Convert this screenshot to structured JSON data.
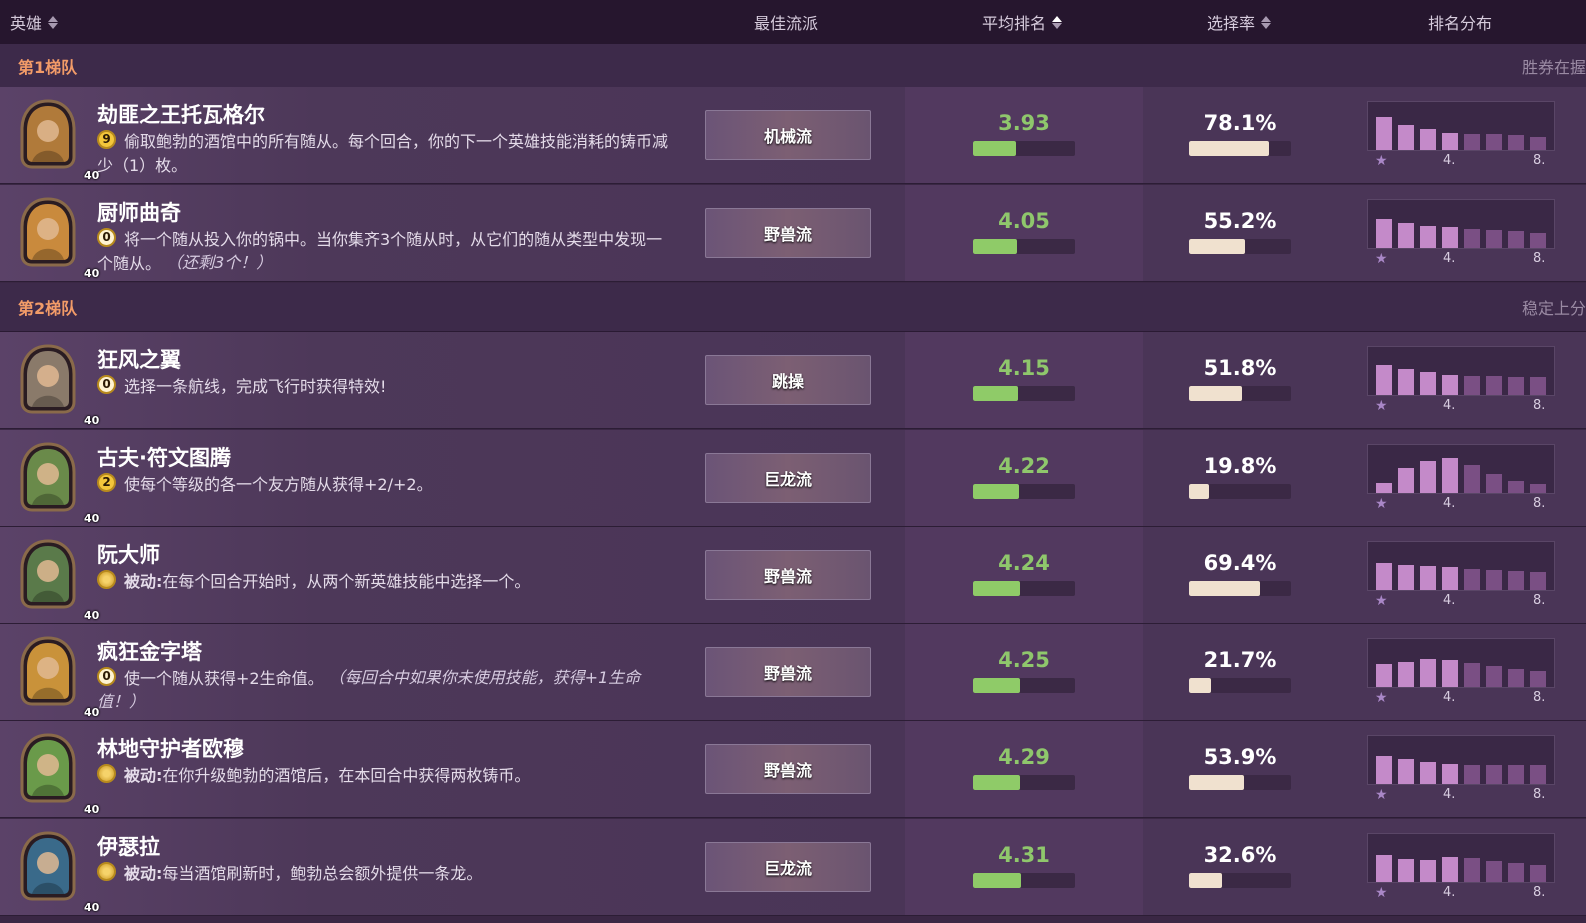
{
  "header": {
    "col_hero": "英雄",
    "col_comp": "最佳流派",
    "col_avg": "平均排名",
    "col_pick": "选择率",
    "col_dist": "排名分布"
  },
  "tiers": [
    {
      "name": "第1梯队",
      "note": "胜券在握"
    },
    {
      "name": "第2梯队",
      "note": "稳定上分"
    }
  ],
  "dist_labels": {
    "star": "★",
    "mid": "4.",
    "end": "8."
  },
  "heroes": [
    {
      "name": "劫匪之王托瓦格尔",
      "cost": "9",
      "desc": "偷取鲍勃的酒馆中的所有随从。每个回合，你的下一个英雄技能消耗的铸币减少（1）枚。",
      "desc_em": "",
      "level": "40",
      "comp": "机械流",
      "avg": "3.93",
      "avg_fill": 0.42,
      "pick": "78.1%",
      "pick_fill": 0.781,
      "dist": [
        0.72,
        0.55,
        0.45,
        0.38,
        0.35,
        0.34,
        0.33,
        0.28
      ],
      "portrait_color": "#b07a3a"
    },
    {
      "name": "厨师曲奇",
      "cost": "0",
      "desc": "将一个随从投入你的锅中。当你集齐3个随从时，从它们的随从类型中发现一个随从。",
      "desc_em": "（还剩3个！）",
      "level": "40",
      "comp": "野兽流",
      "avg": "4.05",
      "avg_fill": 0.43,
      "pick": "55.2%",
      "pick_fill": 0.552,
      "dist": [
        0.62,
        0.55,
        0.48,
        0.45,
        0.42,
        0.4,
        0.36,
        0.33
      ],
      "portrait_color": "#c98a3d"
    },
    {
      "name": "狂风之翼",
      "cost": "0",
      "desc": "选择一条航线，完成飞行时获得特效!",
      "desc_em": "",
      "level": "40",
      "comp": "跳操",
      "avg": "4.15",
      "avg_fill": 0.44,
      "pick": "51.8%",
      "pick_fill": 0.518,
      "dist": [
        0.66,
        0.56,
        0.5,
        0.44,
        0.42,
        0.42,
        0.4,
        0.39
      ],
      "portrait_color": "#8a7a6a"
    },
    {
      "name": "古夫·符文图腾",
      "cost": "2",
      "desc": "使每个等级的各一个友方随从获得+2/+2。",
      "desc_em": "",
      "level": "40",
      "comp": "巨龙流",
      "avg": "4.22",
      "avg_fill": 0.45,
      "pick": "19.8%",
      "pick_fill": 0.198,
      "dist": [
        0.22,
        0.55,
        0.7,
        0.75,
        0.6,
        0.42,
        0.26,
        0.2
      ],
      "portrait_color": "#6a8a4a"
    },
    {
      "name": "阮大师",
      "cost": "•",
      "desc_prefix": "被动:",
      "desc": "在每个回合开始时，从两个新英雄技能中选择一个。",
      "desc_em": "",
      "level": "40",
      "comp": "野兽流",
      "avg": "4.24",
      "avg_fill": 0.46,
      "pick": "69.4%",
      "pick_fill": 0.694,
      "dist": [
        0.58,
        0.54,
        0.52,
        0.5,
        0.46,
        0.44,
        0.42,
        0.4
      ],
      "portrait_color": "#5a7a4a"
    },
    {
      "name": "疯狂金字塔",
      "cost": "0",
      "desc": "使一个随从获得+2生命值。",
      "desc_em": "（每回合中如果你未使用技能，获得+1生命值！）",
      "level": "40",
      "comp": "野兽流",
      "avg": "4.25",
      "avg_fill": 0.46,
      "pick": "21.7%",
      "pick_fill": 0.217,
      "dist": [
        0.5,
        0.54,
        0.6,
        0.58,
        0.52,
        0.46,
        0.4,
        0.34
      ],
      "portrait_color": "#c9923a"
    },
    {
      "name": "林地守护者欧穆",
      "cost": "•",
      "desc_prefix": "被动:",
      "desc": "在你升级鲍勃的酒馆后，在本回合中获得两枚铸币。",
      "desc_em": "",
      "level": "40",
      "comp": "野兽流",
      "avg": "4.29",
      "avg_fill": 0.46,
      "pick": "53.9%",
      "pick_fill": 0.539,
      "dist": [
        0.6,
        0.54,
        0.48,
        0.44,
        0.42,
        0.42,
        0.42,
        0.42
      ],
      "portrait_color": "#6a9a4a"
    },
    {
      "name": "伊瑟拉",
      "cost": "•",
      "desc_prefix": "被动:",
      "desc": "每当酒馆刷新时，鲍勃总会额外提供一条龙。",
      "desc_em": "",
      "level": "40",
      "comp": "巨龙流",
      "avg": "4.31",
      "avg_fill": 0.47,
      "pick": "32.6%",
      "pick_fill": 0.326,
      "dist": [
        0.58,
        0.5,
        0.48,
        0.54,
        0.52,
        0.46,
        0.42,
        0.36
      ],
      "portrait_color": "#3a6a8a"
    }
  ]
}
